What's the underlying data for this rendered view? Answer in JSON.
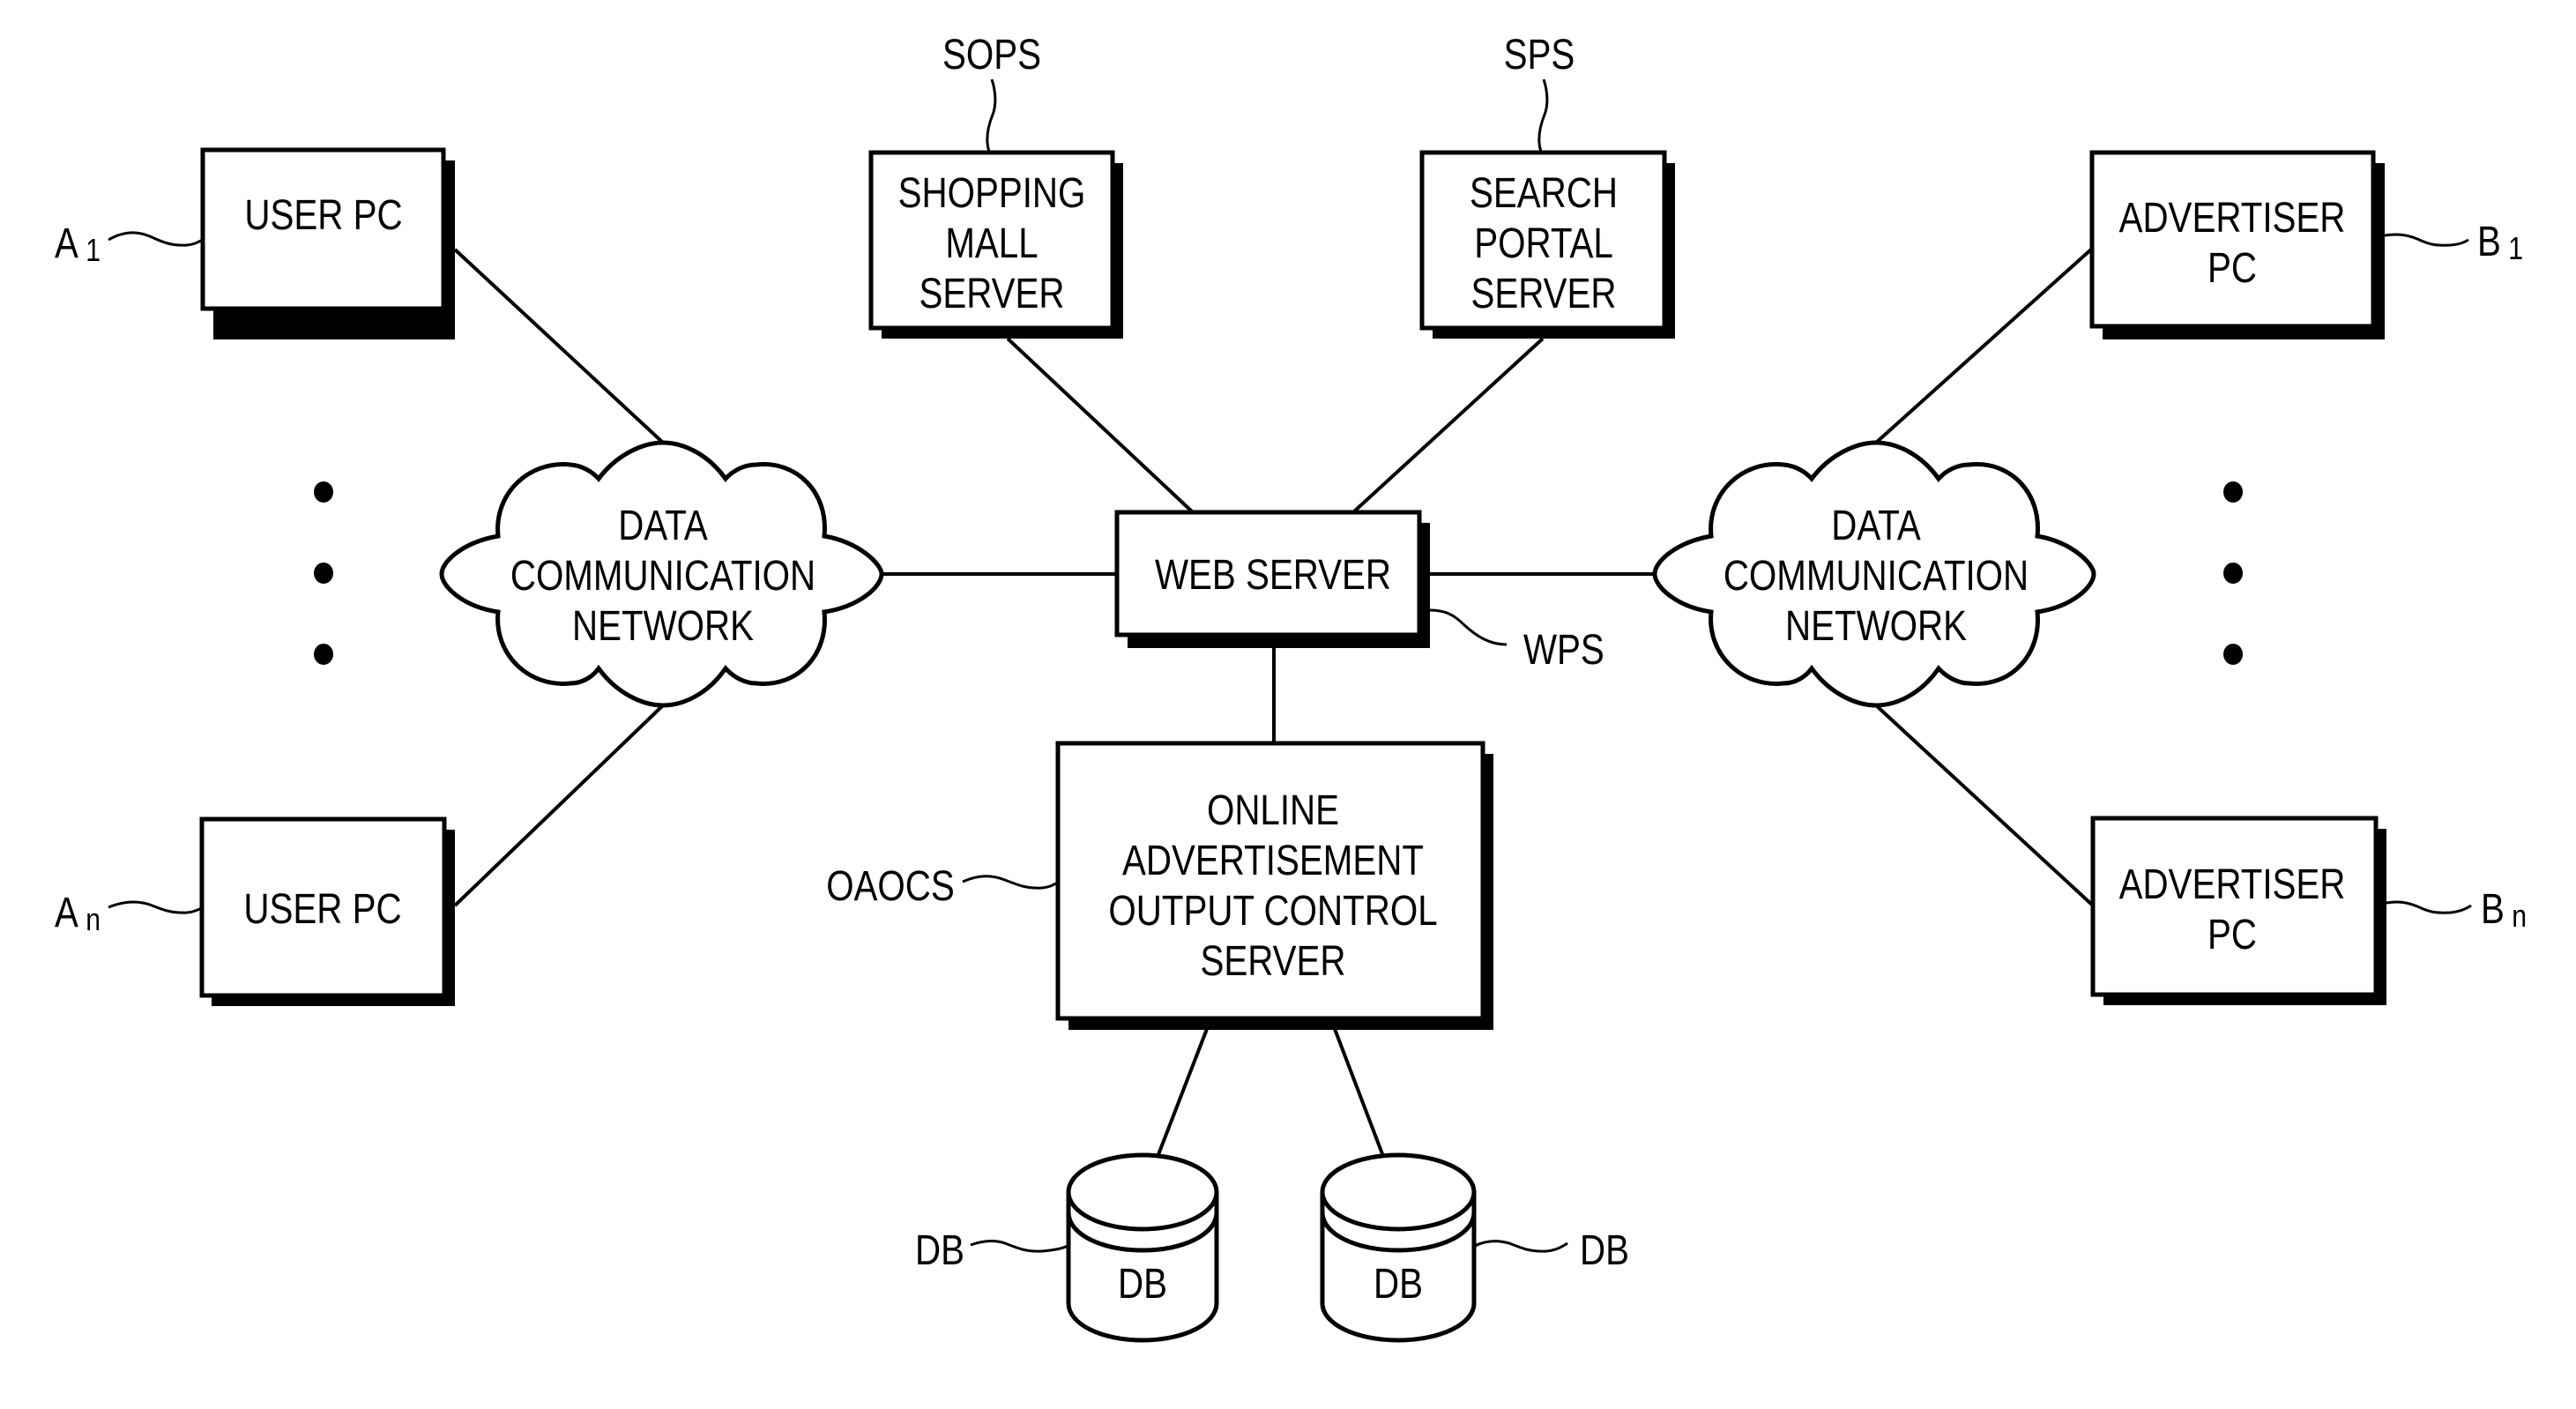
{
  "diagram": {
    "type": "network-architecture",
    "colors": {
      "ink": "#000000",
      "paper": "#ffffff"
    },
    "nodes": {
      "user_pc_1": {
        "lines": [
          "USER PC"
        ],
        "ref": "A",
        "ref_sub": "1"
      },
      "user_pc_n": {
        "lines": [
          "USER PC"
        ],
        "ref": "A",
        "ref_sub": "n"
      },
      "shopping_mall_server": {
        "lines": [
          "SHOPPING",
          "MALL",
          "SERVER"
        ],
        "ref": "SOPS"
      },
      "search_portal_server": {
        "lines": [
          "SEARCH",
          "PORTAL",
          "SERVER"
        ],
        "ref": "SPS"
      },
      "advertiser_pc_1": {
        "lines": [
          "ADVERTISER",
          "PC"
        ],
        "ref": "B",
        "ref_sub": "1"
      },
      "advertiser_pc_n": {
        "lines": [
          "ADVERTISER",
          "PC"
        ],
        "ref": "B",
        "ref_sub": "n"
      },
      "web_server": {
        "lines": [
          "WEB SERVER"
        ],
        "ref": "WPS"
      },
      "oaocs": {
        "lines": [
          "ONLINE",
          "ADVERTISEMENT",
          "OUTPUT CONTROL",
          "SERVER"
        ],
        "ref": "OAOCS"
      },
      "left_network": {
        "lines": [
          "DATA",
          "COMMUNICATION",
          "NETWORK"
        ]
      },
      "right_network": {
        "lines": [
          "DATA",
          "COMMUNICATION",
          "NETWORK"
        ]
      },
      "db_1": {
        "lines": [
          "DB"
        ],
        "ref": "DB"
      },
      "db_2": {
        "lines": [
          "DB"
        ],
        "ref": "DB"
      }
    },
    "edges": [
      [
        "user_pc_1",
        "left_network"
      ],
      [
        "user_pc_n",
        "left_network"
      ],
      [
        "left_network",
        "web_server"
      ],
      [
        "shopping_mall_server",
        "web_server"
      ],
      [
        "search_portal_server",
        "web_server"
      ],
      [
        "web_server",
        "right_network"
      ],
      [
        "right_network",
        "advertiser_pc_1"
      ],
      [
        "right_network",
        "advertiser_pc_n"
      ],
      [
        "web_server",
        "oaocs"
      ],
      [
        "oaocs",
        "db_1"
      ],
      [
        "oaocs",
        "db_2"
      ]
    ],
    "ellipsis": {
      "left": "vertical-dots",
      "right": "vertical-dots"
    }
  }
}
